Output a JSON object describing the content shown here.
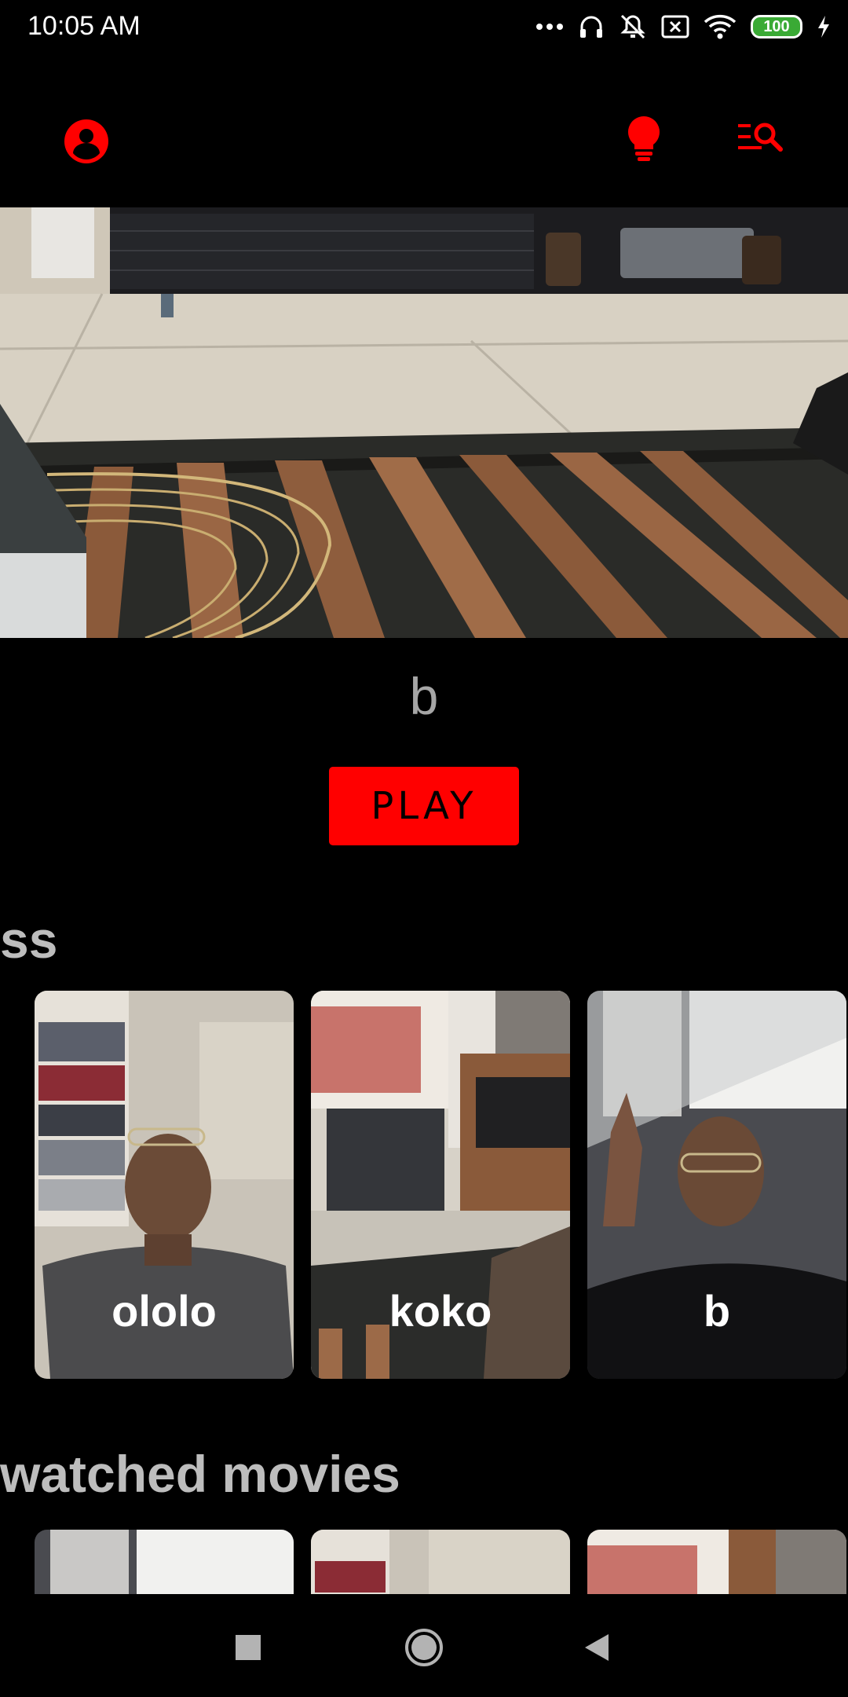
{
  "status_bar": {
    "time": "10:05 AM",
    "battery": "100",
    "icons": [
      "more-dots-icon",
      "headset-icon",
      "mute-icon",
      "sim-x-icon",
      "wifi-icon",
      "battery-icon",
      "charging-icon"
    ]
  },
  "app_bar": {
    "icons": [
      "profile-icon",
      "lightbulb-icon",
      "list-search-icon"
    ],
    "accent": "#ff0000"
  },
  "featured": {
    "title": "b",
    "play_label": "PLAY"
  },
  "sections": [
    {
      "title": "ss",
      "items": [
        {
          "label": "ololo"
        },
        {
          "label": "koko"
        },
        {
          "label": "b"
        }
      ]
    },
    {
      "title": "watched movies",
      "items": [
        {
          "label": ""
        },
        {
          "label": ""
        },
        {
          "label": ""
        }
      ]
    }
  ],
  "nav_bar": {
    "icons": [
      "recent-apps-icon",
      "home-icon",
      "back-icon"
    ]
  }
}
